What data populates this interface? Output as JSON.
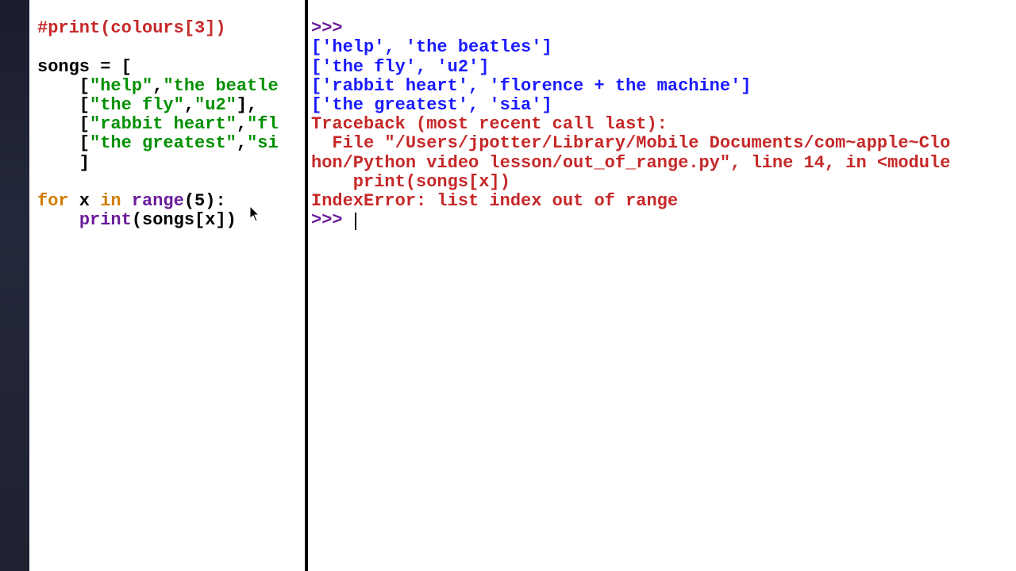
{
  "editor": {
    "top_comment": "#print(colours[3])",
    "assign": "songs = [",
    "row1": {
      "pre": "    [",
      "s1": "\"help\"",
      "sep": ",",
      "s2": "\"the beatle"
    },
    "row2": {
      "pre": "    [",
      "s1": "\"the fly\"",
      "sep": ",",
      "s2": "\"u2\"",
      "close": "],"
    },
    "row3": {
      "pre": "    [",
      "s1": "\"rabbit heart\"",
      "sep": ",",
      "s2": "\"fl"
    },
    "row4": {
      "pre": "    [",
      "s1": "\"the greatest\"",
      "sep": ",",
      "s2": "\"si"
    },
    "closebracket": "    ]",
    "for_kw": "for",
    "for_mid": " x ",
    "in_kw": "in",
    "range_fn": "range",
    "range_args": "(5):",
    "print_fn": "print",
    "print_args": "(songs[x])"
  },
  "shell": {
    "prompt": ">>>",
    "out1": "['help', 'the beatles']",
    "out2": "['the fly', 'u2']",
    "out3": "['rabbit heart', 'florence + the machine']",
    "out4": "['the greatest', 'sia']",
    "trace1": "Traceback (most recent call last):",
    "trace2": "  File \"/Users/jpotter/Library/Mobile Documents/com~apple~Clo",
    "trace3": "hon/Python video lesson/out_of_range.py\", line 14, in <module",
    "trace4": "    print(songs[x])",
    "trace5": "IndexError: list index out of range"
  }
}
